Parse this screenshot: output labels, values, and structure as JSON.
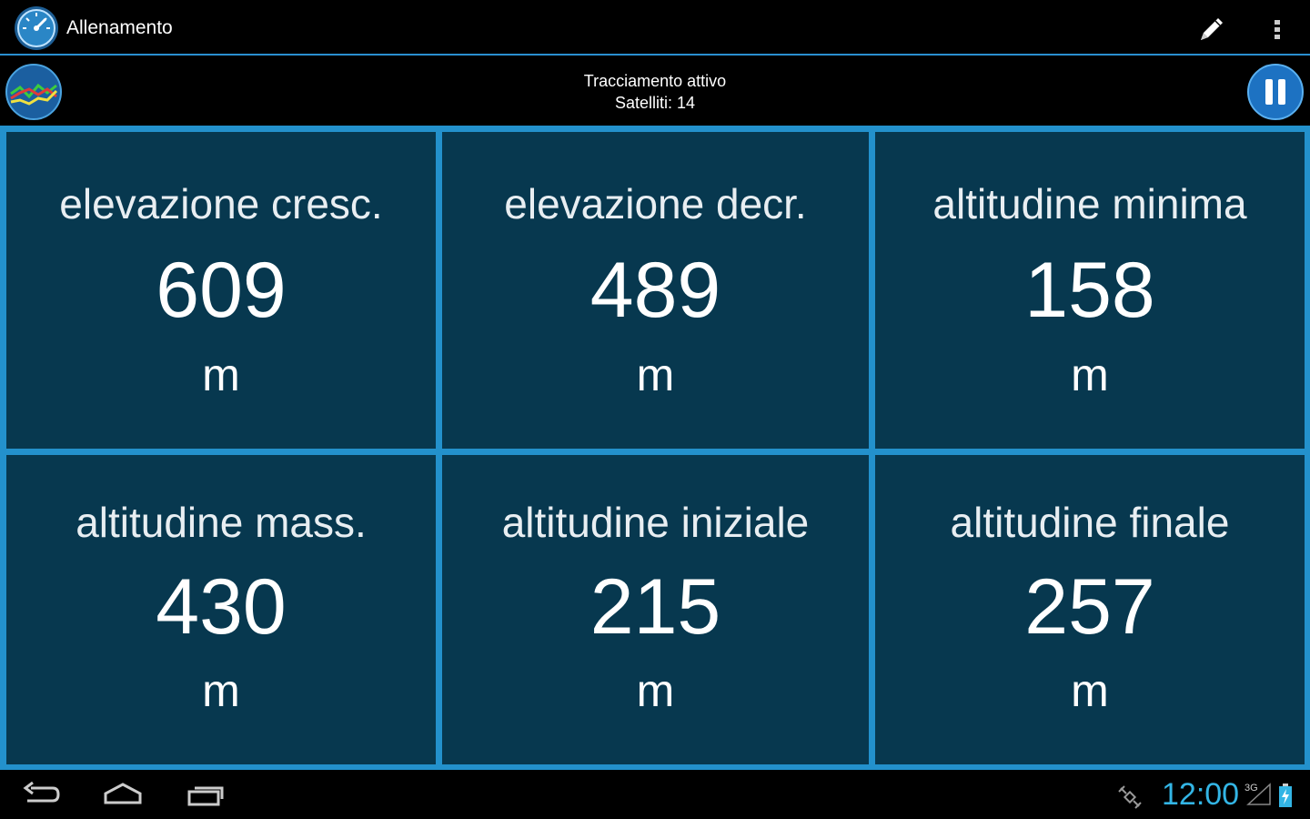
{
  "actionbar": {
    "title": "Allenamento",
    "icons": {
      "app": "speedometer-icon",
      "edit": "pencil-icon",
      "overflow": "overflow-menu-icon"
    }
  },
  "status": {
    "line1": "Tracciamento attivo",
    "line2": "Satelliti: 14",
    "icons": {
      "graph": "chart-lines-icon",
      "pause": "pause-icon"
    }
  },
  "tiles": [
    {
      "label": "elevazione cresc.",
      "value": "609",
      "unit": "m"
    },
    {
      "label": "elevazione decr.",
      "value": "489",
      "unit": "m"
    },
    {
      "label": "altitudine minima",
      "value": "158",
      "unit": "m"
    },
    {
      "label": "altitudine mass.",
      "value": "430",
      "unit": "m"
    },
    {
      "label": "altitudine iniziale",
      "value": "215",
      "unit": "m"
    },
    {
      "label": "altitudine finale",
      "value": "257",
      "unit": "m"
    }
  ],
  "navbar": {
    "clock": "12:00",
    "network": "3G",
    "icons": {
      "back": "back-icon",
      "home": "home-icon",
      "recents": "recents-icon",
      "gps": "gps-satellite-icon",
      "signal": "signal-icon",
      "battery": "battery-charging-icon"
    }
  },
  "colors": {
    "accent": "#2391cc",
    "tile_bg": "#07384f",
    "clock": "#33b5e5"
  }
}
